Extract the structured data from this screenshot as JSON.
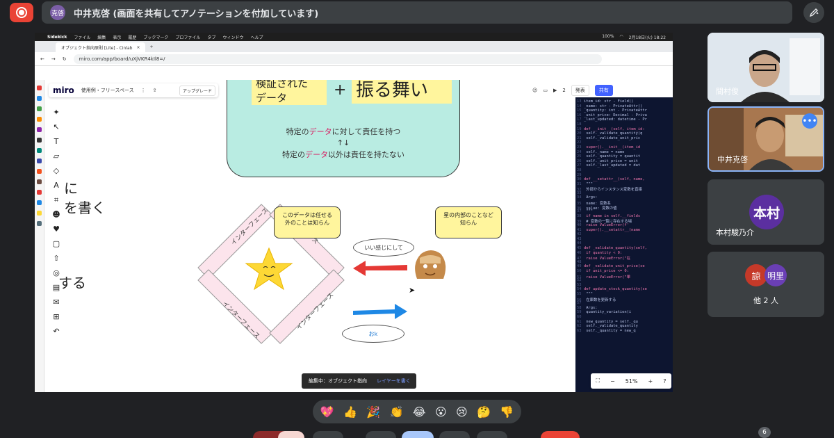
{
  "top_bar": {
    "presenter_initials": "克啓",
    "presenter_name": "中井克啓 (画面を共有してアノテーションを付加しています)"
  },
  "shared_screen": {
    "menubar": {
      "app": "Sidekick",
      "items": [
        "ファイル",
        "編集",
        "表示",
        "履歴",
        "ブックマーク",
        "プロファイル",
        "タブ",
        "ウィンドウ",
        "ヘルプ"
      ],
      "battery": "100%",
      "datetime": "2月18日(火) 18:22"
    },
    "browser": {
      "tab_title": "オブジェクト指向原則 [Lite] - Cinlab",
      "url": "miro.com/app/board/uXjVKR4kIl8=/"
    },
    "miro": {
      "logo": "miro",
      "board_name": "使用例・フリースペース",
      "upgrade": "アップグレード",
      "user_count": "2",
      "present_label": "発表",
      "share_label": "共有"
    },
    "board": {
      "verified_data": "検証された\nデータ",
      "plus": "+",
      "behavior": "振る舞い",
      "responsibility_1_pre": "特定の",
      "responsibility_1_data": "データ",
      "responsibility_1_post": "に対して責任を持つ",
      "arrows": "↑↓",
      "responsibility_2_pre": "特定の",
      "responsibility_2_data": "データ",
      "responsibility_2_post": "以外は責任を持たない",
      "partial_1": "に",
      "partial_2": "を書く",
      "partial_3": "する",
      "bubble_left": "このデータは任せる\n外のことは知らん",
      "bubble_right": "星の内部のことなど\n知らん",
      "oval_top": "いい感じにして",
      "oval_bottom": "おk",
      "diamond_labels": [
        "インターフェース",
        "ース",
        "インターフェース",
        "インターフェース"
      ]
    },
    "code_lines": [
      [
        "13",
        "item_id: str - Field()"
      ],
      [
        "14",
        "_name: str - PrivateAttr()"
      ],
      [
        "15",
        "_quantity: int - PrivateAttr"
      ],
      [
        "16",
        "_unit_price: Decimal - Priva"
      ],
      [
        "17",
        "_last_updated: datetime - Pr"
      ],
      [
        "18",
        ""
      ],
      [
        "19",
        "def __init__(self, item_id:"
      ],
      [
        "20",
        "  self._validate_quantity(q"
      ],
      [
        "21",
        "  self._validate_unit_pric"
      ],
      [
        "22",
        ""
      ],
      [
        "23",
        "  super().__init__(item_id"
      ],
      [
        "24",
        "  self._name = name"
      ],
      [
        "25",
        "  self._quantity = quantit"
      ],
      [
        "26",
        "  self._unit_price = unit"
      ],
      [
        "27",
        "  self._last_updated = dat"
      ],
      [
        "28",
        ""
      ],
      [
        "29",
        ""
      ],
      [
        "30",
        "def __setattr__(self, name,"
      ],
      [
        "31",
        "  \"\"\""
      ],
      [
        "32",
        "  外部からインスタンス変数を直接"
      ],
      [
        "33",
        ""
      ],
      [
        "34",
        "  Args:"
      ],
      [
        "35",
        "    name: 変数名"
      ],
      [
        "36",
        "    value: 変数の値"
      ],
      [
        "37",
        "  \"\"\""
      ],
      [
        "38",
        "  if name in self.__fields"
      ],
      [
        "39",
        "    # 変数の一覧に存在する場"
      ],
      [
        "40",
        "    raise ValueError(f'"
      ],
      [
        "41",
        "  super().__setattr__(name"
      ],
      [
        "42",
        ""
      ],
      [
        "43",
        ""
      ],
      [
        "44",
        ""
      ],
      [
        "45",
        "def _validate_quantity(self,"
      ],
      [
        "46",
        "  if quantity < 0:"
      ],
      [
        "47",
        "    raise ValueError(\"在"
      ],
      [
        "48",
        ""
      ],
      [
        "49",
        "def _validate_unit_price(se"
      ],
      [
        "50",
        "  if unit_price <= 0:"
      ],
      [
        "51",
        "    raise ValueError(\"単"
      ],
      [
        "52",
        ""
      ],
      [
        "53",
        ""
      ],
      [
        "54",
        "def update_stock_quantity(se"
      ],
      [
        "55",
        "  \"\"\""
      ],
      [
        "56",
        "  在庫数を更新する"
      ],
      [
        "57",
        ""
      ],
      [
        "58",
        "  Args:"
      ],
      [
        "59",
        "    quantity_variation(i"
      ],
      [
        "60",
        ""
      ],
      [
        "61",
        "  new_quantity = self._qu"
      ],
      [
        "62",
        "  self._validate_quantity"
      ],
      [
        "63",
        "  self._quantity = new_q"
      ]
    ],
    "status_pill": {
      "label": "編集中：オブジェクト指向",
      "link": "レイヤーを書く"
    },
    "zoom": {
      "level": "51%"
    }
  },
  "participants": [
    {
      "name": "間村俊",
      "type": "video"
    },
    {
      "name": "中井克啓",
      "type": "video"
    },
    {
      "name": "本村駿乃介",
      "type": "avatar",
      "avatar_text": "本村",
      "color": "#5b2fa0"
    },
    {
      "name": "他 2 人",
      "type": "group",
      "avatars": [
        {
          "text": "諒",
          "color": "#c53929"
        },
        {
          "text": "明里",
          "color": "#6a3fb5"
        }
      ]
    }
  ],
  "reactions": [
    "💖",
    "👍",
    "🎉",
    "👏",
    "😂",
    "😮",
    "😢",
    "🤔",
    "👎"
  ],
  "participant_count_badge": "6"
}
